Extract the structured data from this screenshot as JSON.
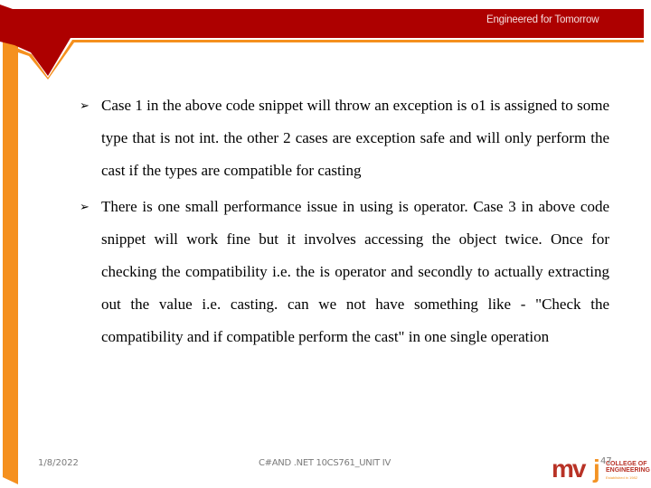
{
  "header": {
    "tagline": "Engineered for Tomorrow",
    "colors": {
      "brand_red": "#ad0000",
      "brand_orange": "#f5901e"
    }
  },
  "content": {
    "bullets": [
      {
        "icon": "arrow-bullet-icon",
        "text": "Case 1 in the above code snippet will throw an exception is o1 is assigned to some type that is not int. the other 2 cases are exception safe and will only perform the cast if the types are compatible for casting"
      },
      {
        "icon": "arrow-bullet-icon",
        "text": "There is one small performance issue in using is operator. Case 3 in above code snippet will work fine but it involves accessing the object twice. Once for checking the compatibility i.e. the is operator and secondly to actually extracting out the value i.e. casting. can we not have something like - \"Check the compatibility and if compatible perform the cast\" in one single operation"
      }
    ]
  },
  "footer": {
    "date": "1/8/2022",
    "course": "C#AND .NET 10CS761_UNIT IV",
    "page_number": "47",
    "logo": {
      "mark": "mv",
      "mark_j": "j",
      "line1": "COLLEGE OF",
      "line2": "ENGINEERING",
      "line3": "Established in 1982"
    }
  }
}
